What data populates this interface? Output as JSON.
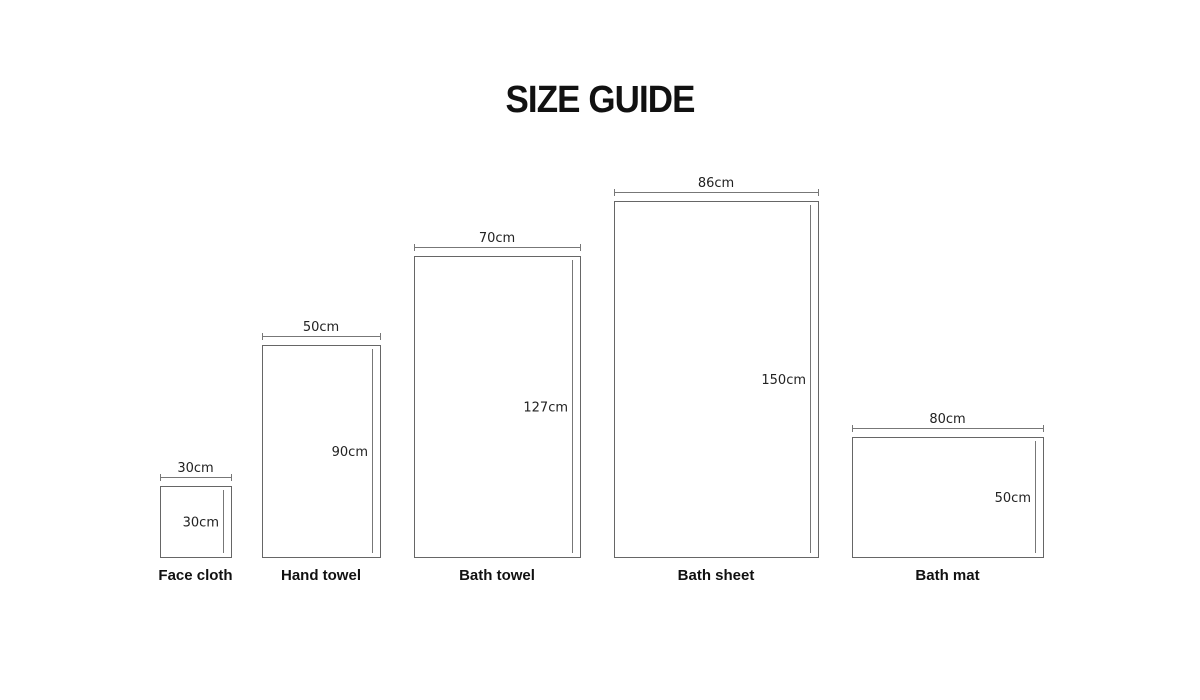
{
  "title": "SIZE GUIDE",
  "items": [
    {
      "name": "Face cloth",
      "width_label": "30cm",
      "height_label": "30cm",
      "width_cm": 30,
      "height_cm": 30
    },
    {
      "name": "Hand towel",
      "width_label": "50cm",
      "height_label": "90cm",
      "width_cm": 50,
      "height_cm": 90
    },
    {
      "name": "Bath towel",
      "width_label": "70cm",
      "height_label": "127cm",
      "width_cm": 70,
      "height_cm": 127
    },
    {
      "name": "Bath sheet",
      "width_label": "86cm",
      "height_label": "150cm",
      "width_cm": 86,
      "height_cm": 150
    },
    {
      "name": "Bath mat",
      "width_label": "80cm",
      "height_label": "50cm",
      "width_cm": 80,
      "height_cm": 50
    }
  ],
  "colors": {
    "outline": "#666666",
    "dimension_line": "#777777",
    "text": "#111111",
    "background": "#ffffff"
  }
}
